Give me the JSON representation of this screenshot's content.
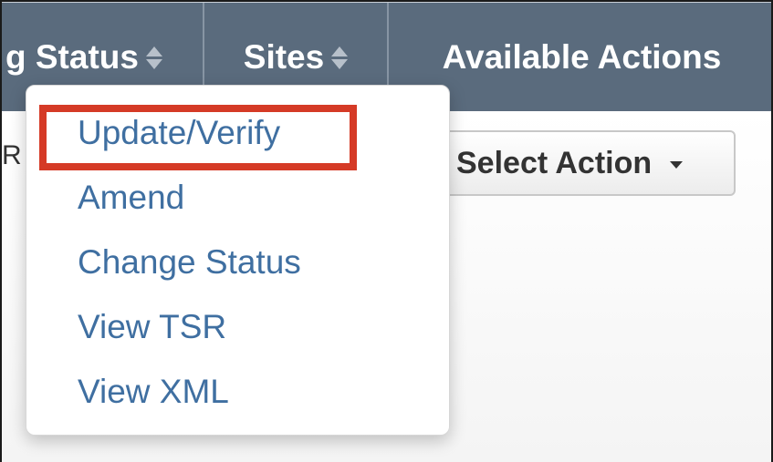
{
  "header": {
    "columns": [
      {
        "label": "g Status",
        "sortable": true
      },
      {
        "label": "Sites",
        "sortable": true
      },
      {
        "label": "Available Actions",
        "sortable": false
      }
    ],
    "background_color": "#5a6b7d"
  },
  "row": {
    "clipped_text": "R",
    "select_action_label": "Select Action"
  },
  "dropdown": {
    "items": [
      {
        "label": "Update/Verify",
        "highlighted": true
      },
      {
        "label": "Amend",
        "highlighted": false
      },
      {
        "label": "Change Status",
        "highlighted": false
      },
      {
        "label": "View TSR",
        "highlighted": false
      },
      {
        "label": "View XML",
        "highlighted": false
      }
    ],
    "link_color": "#3f6fa1",
    "highlight_color": "#d53a26"
  }
}
